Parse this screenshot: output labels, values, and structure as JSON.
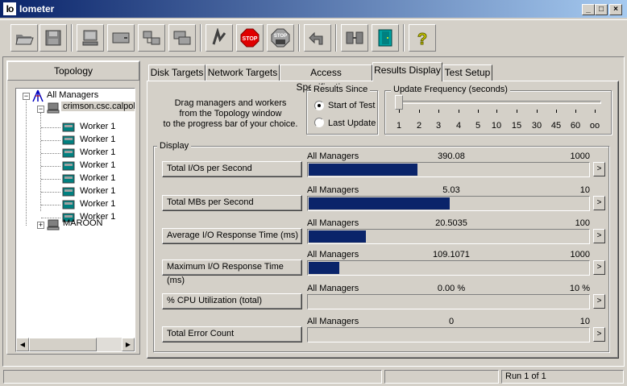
{
  "window": {
    "title": "Iometer",
    "icon_text": "Io"
  },
  "caption_buttons": {
    "minimize": "_",
    "maximize": "□",
    "close": "×"
  },
  "topology": {
    "title": "Topology",
    "root": "All Managers",
    "managers": [
      {
        "name": "crimson.csc.calpol",
        "expand": "−",
        "workers": [
          "Worker 1",
          "Worker 1",
          "Worker 1",
          "Worker 1",
          "Worker 1",
          "Worker 1",
          "Worker 1",
          "Worker 1"
        ]
      },
      {
        "name": "MAROON",
        "expand": "+"
      }
    ],
    "root_expand": "−"
  },
  "tabs": [
    {
      "label": "Disk Targets"
    },
    {
      "label": "Network Targets"
    },
    {
      "label": "Access Specifications"
    },
    {
      "label": "Results Display",
      "active": true
    },
    {
      "label": "Test Setup"
    }
  ],
  "instructions": "Drag managers and workers\nfrom the Topology window\nto the progress bar of your choice.",
  "results_since": {
    "title": "Results Since",
    "options": [
      {
        "label": "Start of Test",
        "selected": true
      },
      {
        "label": "Last Update",
        "selected": false
      }
    ]
  },
  "update_frequency": {
    "title": "Update Frequency (seconds)",
    "ticks": [
      "1",
      "2",
      "3",
      "4",
      "5",
      "10",
      "15",
      "30",
      "45",
      "60",
      "oo"
    ],
    "selected_index": 0
  },
  "display": {
    "title": "Display",
    "rows": [
      {
        "button": "Total I/Os per Second",
        "source": "All Managers",
        "value": "390.08",
        "max": "1000",
        "fraction": 0.39
      },
      {
        "button": "Total MBs per Second",
        "source": "All Managers",
        "value": "5.03",
        "max": "10",
        "fraction": 0.503
      },
      {
        "button": "Average I/O Response Time (ms)",
        "source": "All Managers",
        "value": "20.5035",
        "max": "100",
        "fraction": 0.205
      },
      {
        "button": "Maximum I/O Response Time (ms)",
        "source": "All Managers",
        "value": "109.1071",
        "max": "1000",
        "fraction": 0.109
      },
      {
        "button": "% CPU Utilization (total)",
        "source": "All Managers",
        "value": "0.00 %",
        "max": "10 %",
        "fraction": 0
      },
      {
        "button": "Total Error Count",
        "source": "All Managers",
        "value": "0",
        "max": "10",
        "fraction": 0
      }
    ],
    "arrow": ">"
  },
  "status_bar": {
    "run": "Run 1 of 1"
  },
  "colors": {
    "bar": "#0a246a",
    "titlebar": "#0a246a"
  }
}
